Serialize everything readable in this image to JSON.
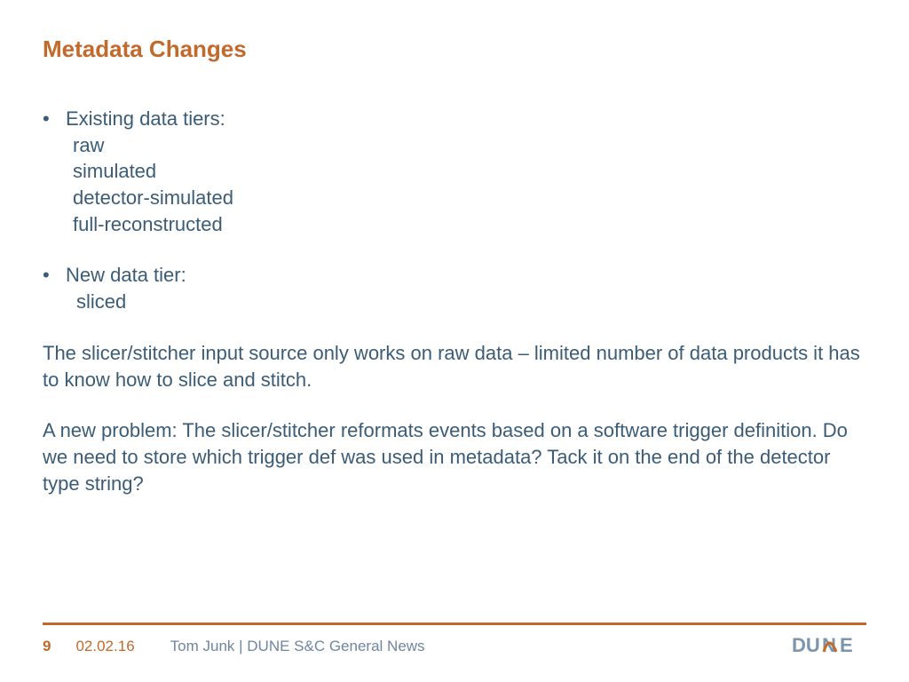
{
  "title": "Metadata Changes",
  "bullets": {
    "b1": {
      "label": "Existing data tiers:",
      "items": [
        "raw",
        "simulated",
        "detector-simulated",
        "full-reconstructed"
      ]
    },
    "b2": {
      "label": "New data tier:",
      "items": [
        "sliced"
      ]
    }
  },
  "paras": [
    "The slicer/stitcher input source only works on raw data – limited number of data products it has to know how to slice and stitch.",
    "A new problem:  The slicer/stitcher reformats events based on a software trigger definition.  Do we need to store which trigger def was used in metadata?  Tack it on the end of the detector type string?"
  ],
  "footer": {
    "page": "9",
    "date": "02.02.16",
    "author": "Tom Junk | DUNE S&C General News"
  },
  "logo_text": "DUNE"
}
